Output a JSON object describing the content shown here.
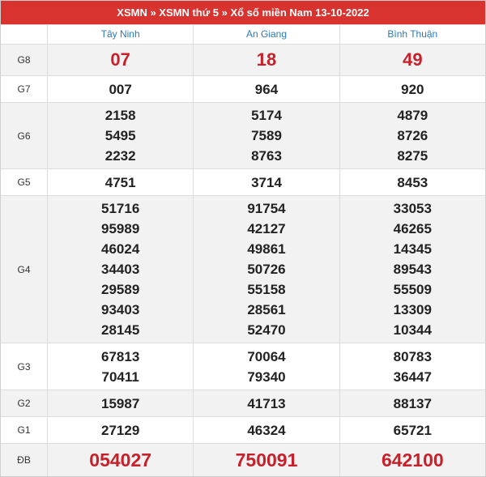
{
  "title": "XSMN » XSMN thứ 5 » Xổ số miền Nam 13-10-2022",
  "provinces": [
    "Tây Ninh",
    "An Giang",
    "Bình Thuận"
  ],
  "prizes": {
    "g8": {
      "label": "G8",
      "values": [
        [
          "07"
        ],
        [
          "18"
        ],
        [
          "49"
        ]
      ]
    },
    "g7": {
      "label": "G7",
      "values": [
        [
          "007"
        ],
        [
          "964"
        ],
        [
          "920"
        ]
      ]
    },
    "g6": {
      "label": "G6",
      "values": [
        [
          "2158",
          "5495",
          "2232"
        ],
        [
          "5174",
          "7589",
          "8763"
        ],
        [
          "4879",
          "8726",
          "8275"
        ]
      ]
    },
    "g5": {
      "label": "G5",
      "values": [
        [
          "4751"
        ],
        [
          "3714"
        ],
        [
          "8453"
        ]
      ]
    },
    "g4": {
      "label": "G4",
      "values": [
        [
          "51716",
          "95989",
          "46024",
          "34403",
          "29589",
          "93403",
          "28145"
        ],
        [
          "91754",
          "42127",
          "49861",
          "50726",
          "55158",
          "28561",
          "52470"
        ],
        [
          "33053",
          "46265",
          "14345",
          "89543",
          "55509",
          "13309",
          "10344"
        ]
      ]
    },
    "g3": {
      "label": "G3",
      "values": [
        [
          "67813",
          "70411"
        ],
        [
          "70064",
          "79340"
        ],
        [
          "80783",
          "36447"
        ]
      ]
    },
    "g2": {
      "label": "G2",
      "values": [
        [
          "15987"
        ],
        [
          "41713"
        ],
        [
          "88137"
        ]
      ]
    },
    "g1": {
      "label": "G1",
      "values": [
        [
          "27129"
        ],
        [
          "46324"
        ],
        [
          "65721"
        ]
      ]
    },
    "db": {
      "label": "ĐB",
      "values": [
        [
          "054027"
        ],
        [
          "750091"
        ],
        [
          "642100"
        ]
      ]
    }
  },
  "colors": {
    "header_bg": "#d9332f",
    "special_text": "#c8202a",
    "province_text": "#2a7ab8"
  }
}
